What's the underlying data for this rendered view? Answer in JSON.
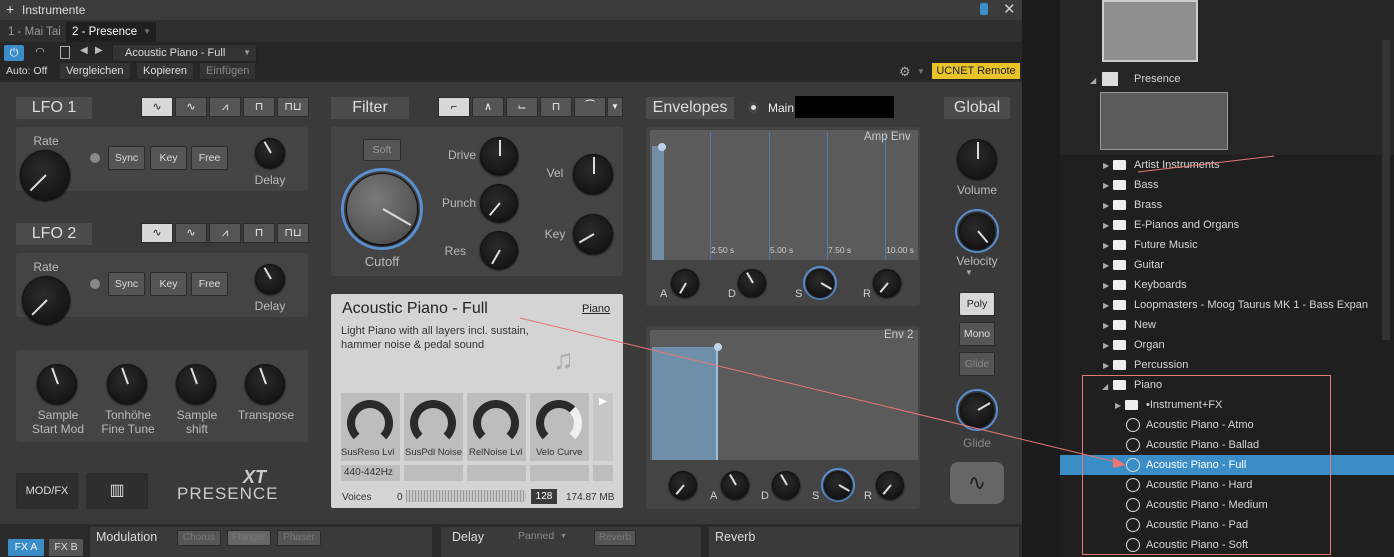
{
  "window": {
    "title": "Instrumente",
    "tabs": [
      "1 - Mai Tai",
      "2 - Presence"
    ]
  },
  "toolbar": {
    "preset": "Acoustic Piano - Full",
    "auto": "Auto: Off",
    "compare": "Vergleichen",
    "copy": "Kopieren",
    "paste": "Einfügen",
    "ucnet": "UCNET Remote"
  },
  "lfo1": {
    "title": "LFO 1",
    "rate": "Rate",
    "sync": "Sync",
    "key": "Key",
    "free": "Free",
    "delay": "Delay"
  },
  "lfo2": {
    "title": "LFO 2",
    "rate": "Rate",
    "sync": "Sync",
    "key": "Key",
    "free": "Free",
    "delay": "Delay"
  },
  "macros": [
    {
      "l1": "Sample",
      "l2": "Start Mod"
    },
    {
      "l1": "Tonhöhe",
      "l2": "Fine Tune"
    },
    {
      "l1": "Sample",
      "l2": "shift"
    },
    {
      "l1": "Transpose",
      "l2": ""
    }
  ],
  "modfx": "MOD/FX",
  "logo": {
    "xt": "XT",
    "name": "PRESENCE"
  },
  "filter": {
    "title": "Filter",
    "soft": "Soft",
    "drive": "Drive",
    "punch": "Punch",
    "res": "Res",
    "vel": "Vel",
    "key": "Key",
    "cutoff": "Cutoff"
  },
  "preset_panel": {
    "name": "Acoustic Piano - Full",
    "category": "Piano",
    "desc": "Light Piano with all layers incl. sustain, hammer noise & pedal sound",
    "knobs": [
      "SusReso Lvl",
      "SusPdl Noise",
      "RelNoise Lvl",
      "Velo Curve"
    ],
    "tag": "440-442Hz",
    "voices": "Voices",
    "voices_min": "0",
    "voices_val": "128",
    "size": "174.87 MB"
  },
  "envelopes": {
    "title": "Envelopes",
    "main": "Main",
    "amp": "Amp Env",
    "env2": "Env 2",
    "ticks": [
      "2.50 s",
      "5.00 s",
      "7.50 s",
      "10.00 s"
    ],
    "adsr": [
      "A",
      "D",
      "S",
      "R"
    ]
  },
  "global": {
    "title": "Global",
    "volume": "Volume",
    "velocity": "Velocity",
    "poly": "Poly",
    "mono": "Mono",
    "glide_btn": "Glide",
    "glide": "Glide"
  },
  "bottom": {
    "fxa": "FX A",
    "fxb": "FX B",
    "modulation": "Modulation",
    "chorus": "Chorus",
    "flanger": "Flanger",
    "phaser": "Phaser",
    "delay": "Delay",
    "panned": "Panned",
    "reverb_btn": "Reverb",
    "reverb": "Reverb"
  },
  "browser": {
    "presence": "Presence",
    "folders": [
      "Artist Instruments",
      "Bass",
      "Brass",
      "E-Pianos and Organs",
      "Future Music",
      "Guitar",
      "Keyboards",
      "Loopmasters - Moog Taurus MK 1 - Bass Expan",
      "New",
      "Organ",
      "Percussion"
    ],
    "piano": "Piano",
    "instrumentfx": "•Instrument+FX",
    "presets": [
      "Acoustic Piano - Atmo",
      "Acoustic Piano - Ballad",
      "Acoustic Piano - Full",
      "Acoustic Piano - Hard",
      "Acoustic Piano - Medium",
      "Acoustic Piano - Pad",
      "Acoustic Piano - Soft"
    ],
    "selected_index": 2
  },
  "colors": {
    "accent": "#3a8dc6",
    "highlight": "#e8776f",
    "ucnet": "#e8c32a"
  }
}
